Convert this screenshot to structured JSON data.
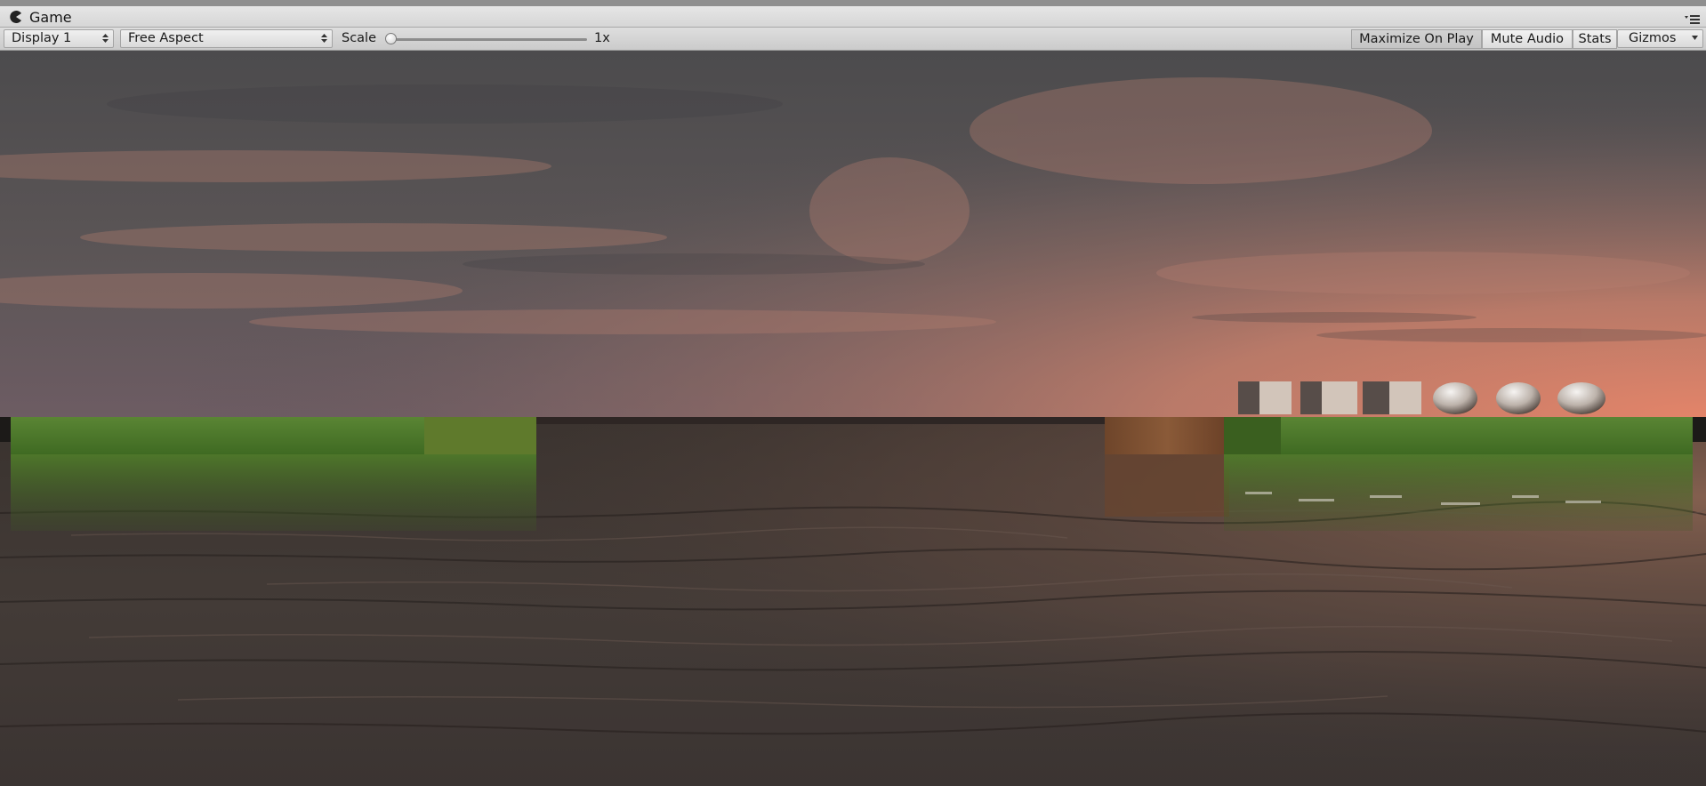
{
  "window": {
    "tab_title": "Game",
    "tab_icon": "pacman-game-icon",
    "panel_menu_icon": "panel-menu-icon"
  },
  "toolbar": {
    "display_select": "Display 1",
    "aspect_select": "Free Aspect",
    "scale_label": "Scale",
    "scale_value": "1x",
    "scale_level": 0.0,
    "maximize_on_play": "Maximize On Play",
    "mute_audio": "Mute Audio",
    "stats": "Stats",
    "gizmos": "Gizmos"
  },
  "colors": {
    "sky_top": "#4f4f52",
    "sky_horizon_warm": "#d88a6e",
    "water": "#3d3735",
    "grass": "#4b7a2a",
    "wood": "#7a4a2a"
  },
  "scene": {
    "objects": [
      "cube",
      "cube",
      "cube",
      "sphere",
      "sphere",
      "sphere"
    ]
  }
}
